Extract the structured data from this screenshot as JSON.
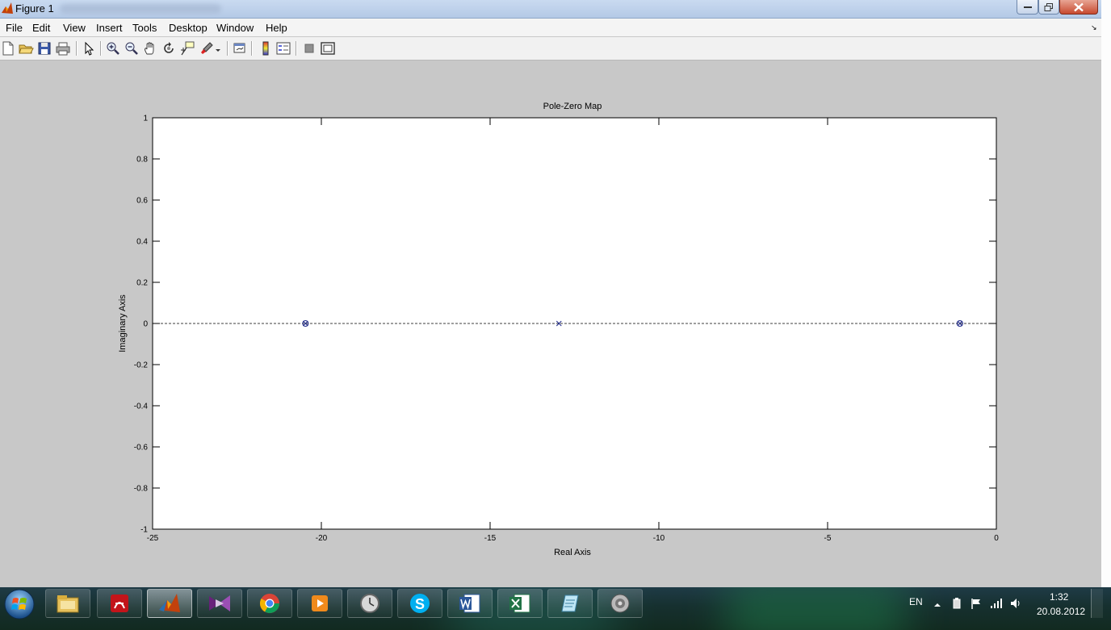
{
  "window": {
    "title": "Figure 1"
  },
  "menu": [
    "File",
    "Edit",
    "View",
    "Insert",
    "Tools",
    "Desktop",
    "Window",
    "Help"
  ],
  "toolbar_icons": [
    "new-figure-icon",
    "open-file-icon",
    "save-icon",
    "print-icon",
    "edit-plot-arrow-icon",
    "zoom-in-icon",
    "zoom-out-icon",
    "pan-hand-icon",
    "rotate-3d-icon",
    "data-cursor-icon",
    "brush-icon",
    "brush-dropdown-icon",
    "link-plot-icon",
    "insert-colorbar-icon",
    "insert-legend-icon",
    "hide-plot-tools-icon",
    "show-plot-tools-icon"
  ],
  "colors": {
    "marker": "#1f2a8a",
    "axes_bg": "#ffffff",
    "figure_bg": "#c8c8c8"
  },
  "chart_data": {
    "type": "scatter",
    "title": "Pole-Zero Map",
    "xlabel": "Real Axis",
    "ylabel": "Imaginary Axis",
    "xlim": [
      -25,
      0
    ],
    "ylim": [
      -1,
      1
    ],
    "xticks": [
      -25,
      -20,
      -15,
      -10,
      -5,
      0
    ],
    "xtick_labels": [
      "-25",
      "-20",
      "-15",
      "-10",
      "-5",
      "0"
    ],
    "yticks": [
      1,
      0.8,
      0.6,
      0.4,
      0.2,
      0,
      -0.2,
      -0.4,
      -0.6,
      -0.8,
      -1
    ],
    "ytick_labels": [
      "1",
      "0.8",
      "0.6",
      "0.4",
      "0.2",
      "0",
      "-0.2",
      "-0.4",
      "-0.6",
      "-0.8",
      "-1"
    ],
    "grid": false,
    "reference_line_y": 0,
    "poles": [
      {
        "x": -20.47,
        "y": 0
      },
      {
        "x": -12.96,
        "y": 0
      },
      {
        "x": -1.08,
        "y": 0
      }
    ],
    "zeros": [
      {
        "x": -20.47,
        "y": 0
      },
      {
        "x": -1.08,
        "y": 0
      }
    ]
  },
  "taskbar": {
    "apps": [
      "windows-explorer-icon",
      "acrobat-icon",
      "matlab-icon",
      "visual-studio-icon",
      "chrome-icon",
      "media-player-icon",
      "clock-gadget-icon",
      "skype-icon",
      "word-icon",
      "excel-icon",
      "notepad-icon",
      "speaker-icon"
    ],
    "language": "EN",
    "time": "1:32",
    "date": "20.08.2012"
  }
}
